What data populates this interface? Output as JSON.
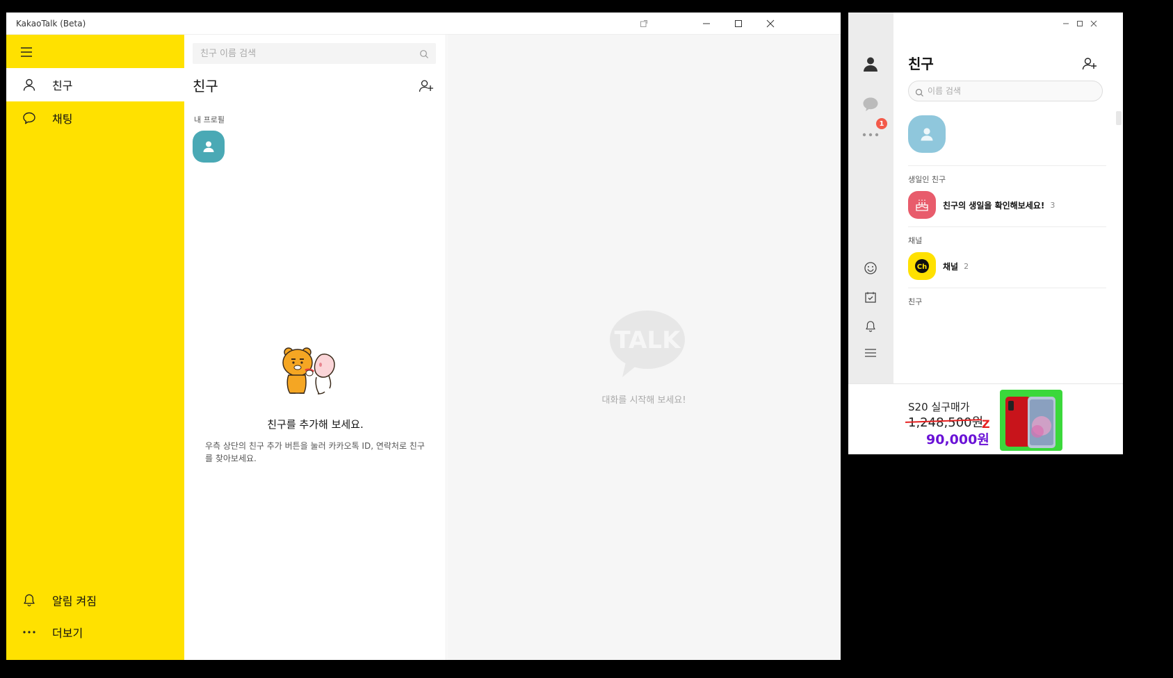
{
  "win1": {
    "title": "KakaoTalk (Beta)",
    "sidebar": {
      "items": [
        {
          "label": "친구",
          "icon": "person-icon"
        },
        {
          "label": "채팅",
          "icon": "chat-bubble-icon"
        }
      ],
      "bottom_items": [
        {
          "label": "알림 켜짐",
          "icon": "bell-icon"
        },
        {
          "label": "더보기",
          "icon": "more-icon"
        }
      ],
      "bg_color": "#FFE100"
    },
    "friends": {
      "search_placeholder": "친구 이름 검색",
      "heading": "친구",
      "my_profile_label": "내 프로필",
      "empty_title": "친구를 추가해 보세요.",
      "empty_desc": "우측 상단의 친구 추가 버튼을 눌러 카카오톡 ID, 연락처로 친구를 찾아보세요."
    },
    "chat": {
      "logo_text": "TALK",
      "hint": "대화를 시작해 보세요!"
    }
  },
  "win2": {
    "heading": "친구",
    "search_placeholder": "이름 검색",
    "badge_count": "1",
    "sections": {
      "birthday_label": "생일인 친구",
      "birthday_text": "친구의 생일을 확인해보세요!",
      "birthday_count": "3",
      "channel_label": "채널",
      "channel_text": "채널",
      "channel_count": "2",
      "friends_label": "친구"
    },
    "channel_badge_text": "Ch",
    "ad": {
      "title": "S20 실구매가",
      "old_price": "1,248,500원",
      "new_price": "90,000원",
      "z_mark": "Z"
    }
  }
}
